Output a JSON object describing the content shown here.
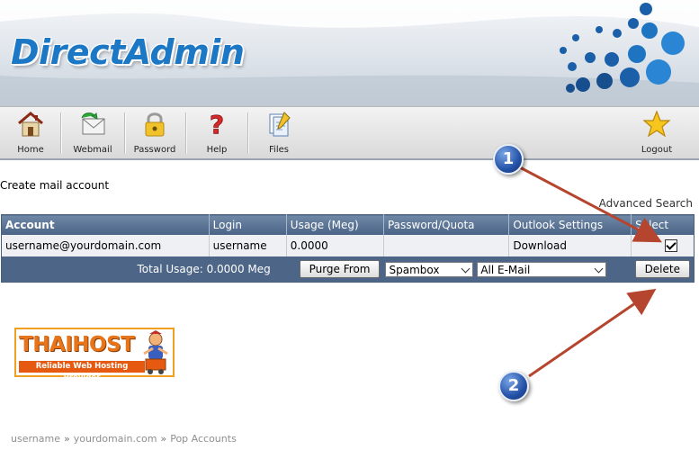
{
  "header": {
    "brand": "DirectAdmin"
  },
  "toolbar": {
    "items": [
      {
        "label": "Home",
        "icon": "home-icon"
      },
      {
        "label": "Webmail",
        "icon": "webmail-icon"
      },
      {
        "label": "Password",
        "icon": "lock-icon"
      },
      {
        "label": "Help",
        "icon": "help-icon"
      },
      {
        "label": "Files",
        "icon": "files-icon"
      },
      {
        "label": "Logout",
        "icon": "star-icon"
      }
    ]
  },
  "page": {
    "title": "Create mail account",
    "advanced_search": "Advanced Search"
  },
  "table": {
    "columns": [
      "Account",
      "Login",
      "Usage (Meg)",
      "Password/Quota",
      "Outlook Settings",
      "Select"
    ],
    "rows": [
      {
        "account": "username@yourdomain.com",
        "login": "username",
        "usage": "0.0000",
        "password_quota": "",
        "outlook": "Download",
        "selected": true
      }
    ],
    "footer": {
      "total_usage": "Total Usage: 0.0000 Meg",
      "purge_button": "Purge From",
      "purge_folder": "Spambox",
      "purge_filter": "All E-Mail",
      "delete_button": "Delete"
    }
  },
  "logo": {
    "name": "THAIHOST",
    "tagline": "Reliable Web Hosting Provider"
  },
  "breadcrumb": [
    "username",
    "yourdomain.com",
    "Pop Accounts"
  ],
  "callouts": [
    "1",
    "2"
  ],
  "colors": {
    "brand_blue": "#1c78c4",
    "table_header": "#4a6386",
    "arrow_red": "#b5452e",
    "logo_orange": "#e8751a"
  }
}
